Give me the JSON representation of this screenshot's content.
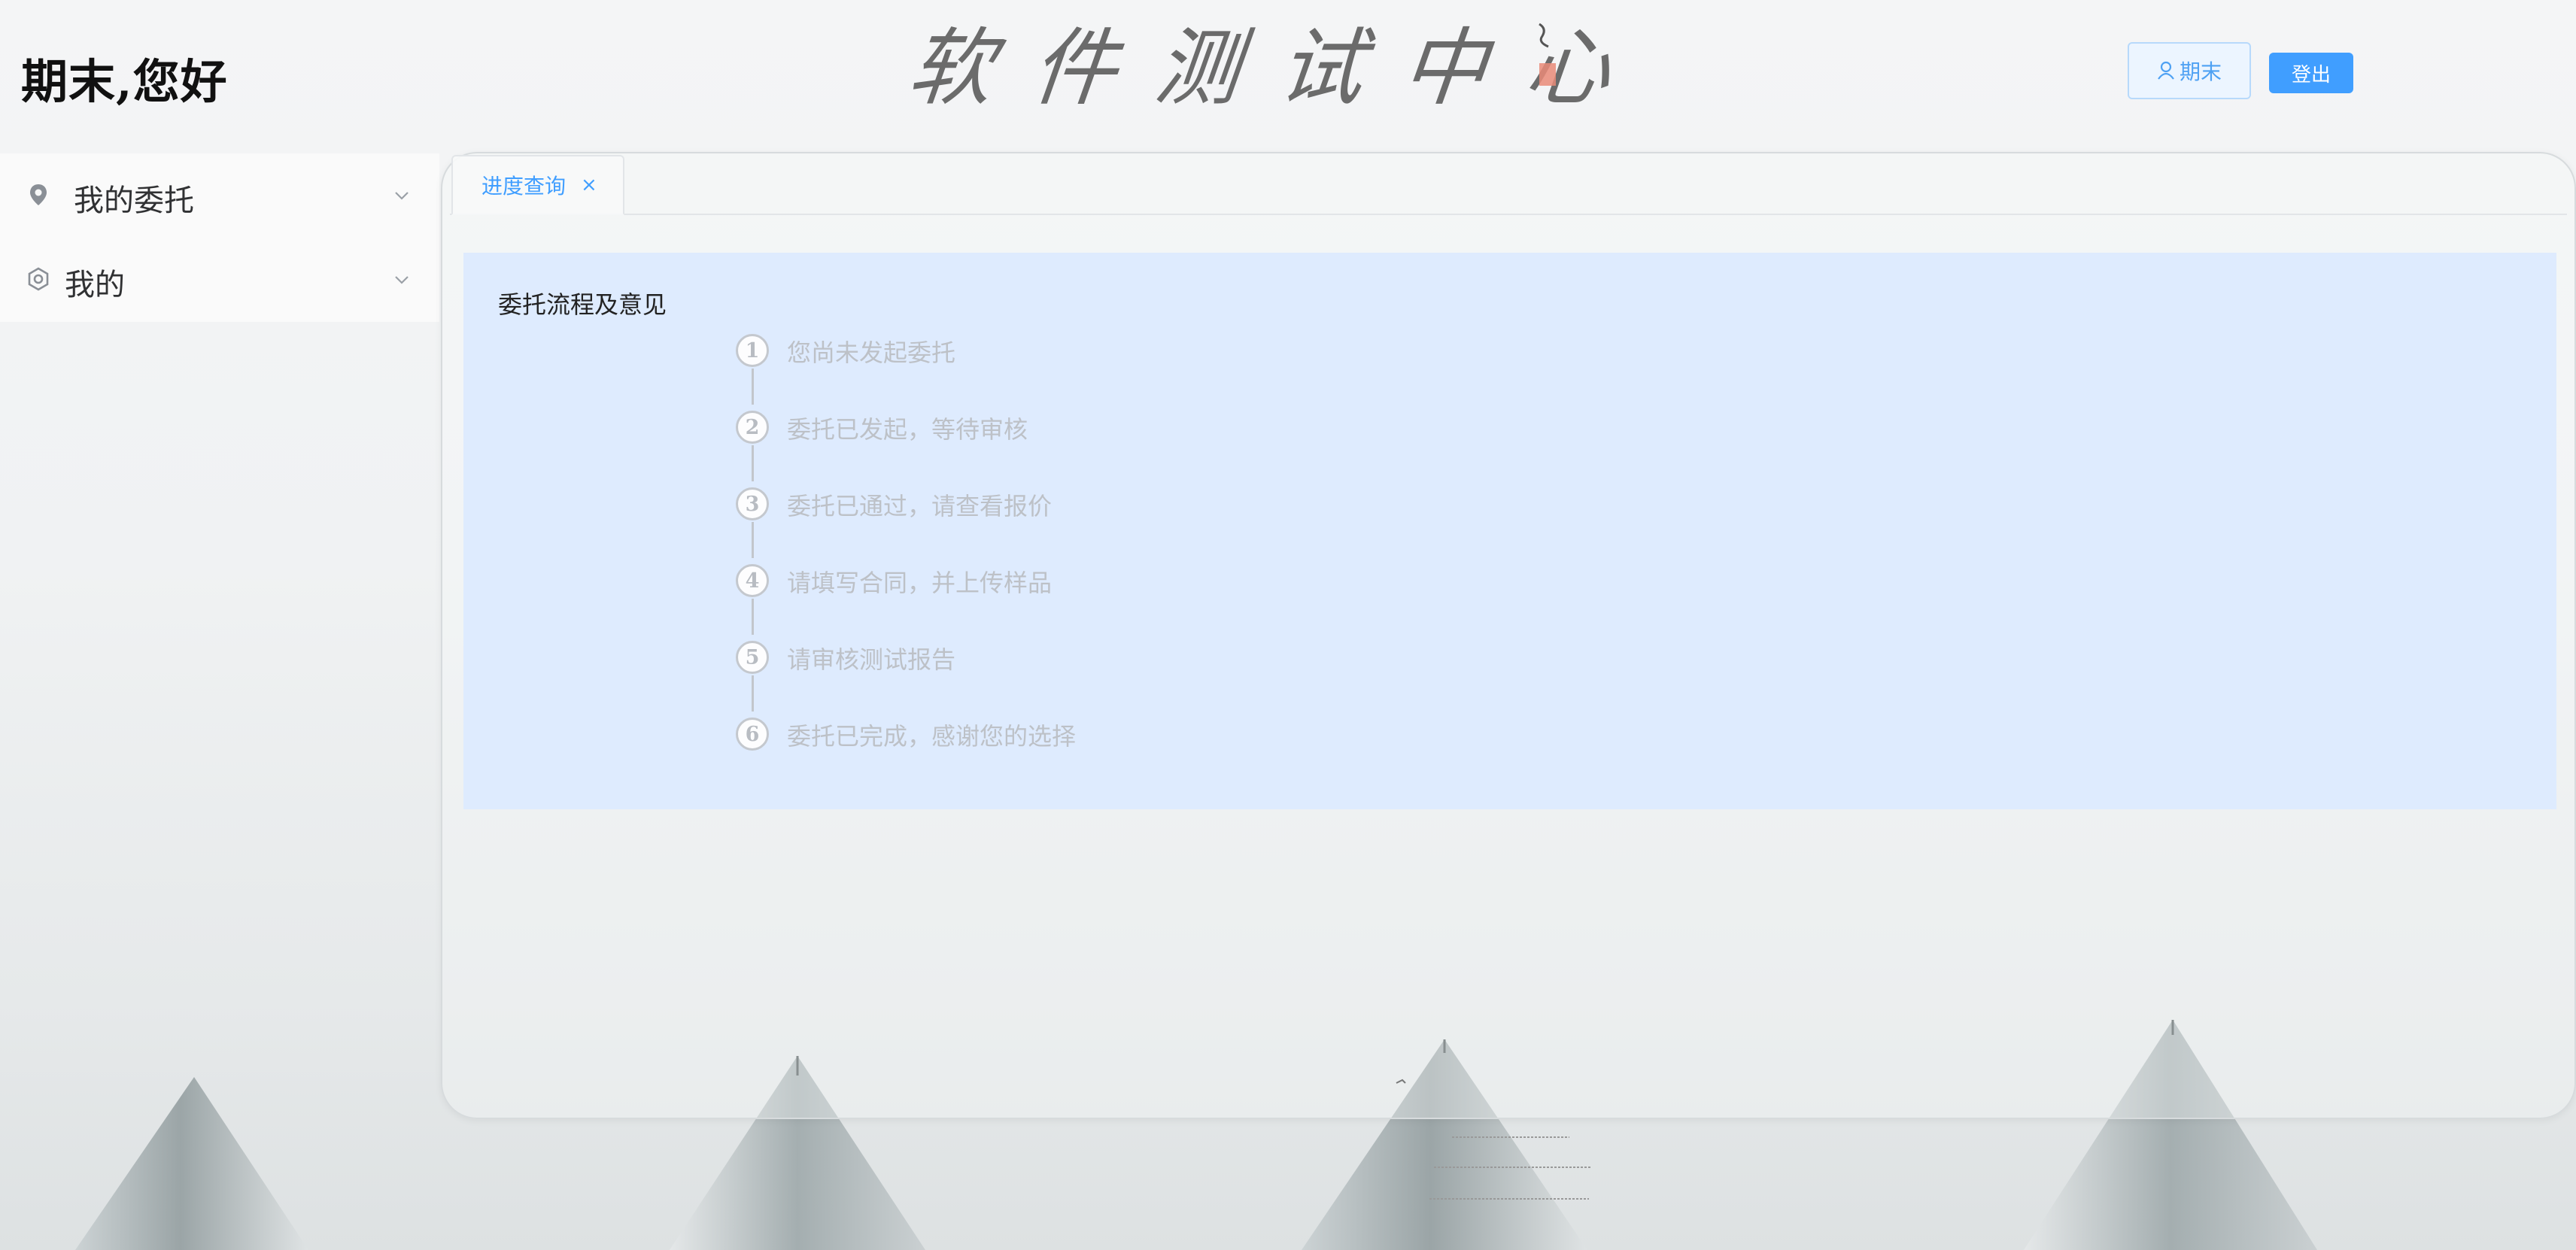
{
  "header": {
    "greeting": "期末,您好",
    "logo_title": "软件测试中心",
    "user_button_label": "期末",
    "logout_label": "登出"
  },
  "sidebar": {
    "items": [
      {
        "label": "我的委托",
        "icon": "location-pin-icon"
      },
      {
        "label": "我的",
        "icon": "gear-icon"
      }
    ]
  },
  "tabs": [
    {
      "label": "进度查询",
      "close": "×"
    }
  ],
  "progress": {
    "title": "委托流程及意见",
    "steps": [
      {
        "num": "1",
        "text": "您尚未发起委托"
      },
      {
        "num": "2",
        "text": "委托已发起，等待审核"
      },
      {
        "num": "3",
        "text": "委托已通过，请查看报价"
      },
      {
        "num": "4",
        "text": "请填写合同，并上传样品"
      },
      {
        "num": "5",
        "text": "请审核测试报告"
      },
      {
        "num": "6",
        "text": "委托已完成，感谢您的选择"
      }
    ]
  },
  "colors": {
    "accent": "#409eff",
    "card_background": "#deebfe",
    "step_inactive": "#bdc1c7"
  }
}
